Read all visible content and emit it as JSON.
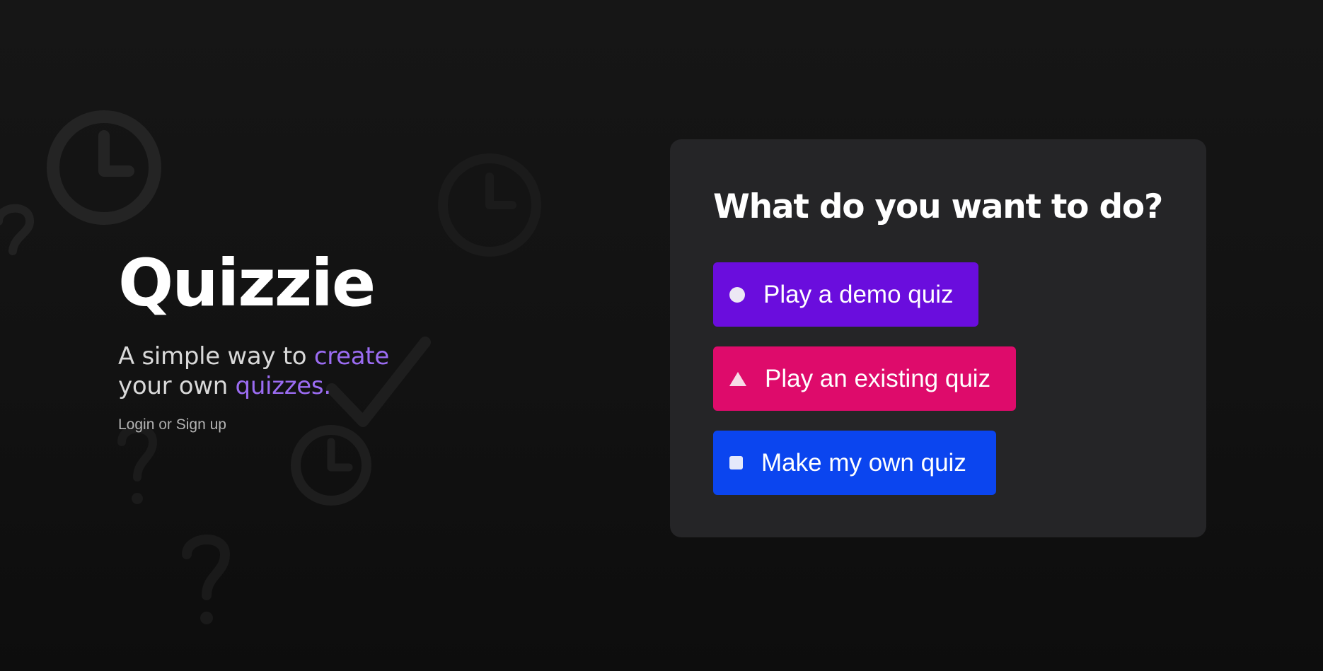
{
  "app": {
    "title": "Quizzie",
    "tagline_part1": "A simple way to ",
    "tagline_accent1": "create",
    "tagline_part2": "your own ",
    "tagline_accent2": "quizzes.",
    "auth_login": "Login",
    "auth_or": " or ",
    "auth_signup": "Sign up"
  },
  "card": {
    "heading": "What do you want to do?",
    "options": [
      {
        "label": "Play a demo quiz",
        "icon": "circle-icon",
        "color": "#6a0ddd"
      },
      {
        "label": "Play an existing quiz",
        "icon": "triangle-icon",
        "color": "#de0b6b"
      },
      {
        "label": "Make my own quiz",
        "icon": "square-icon",
        "color": "#0b45ef"
      }
    ]
  },
  "colors": {
    "background": "#141414",
    "card": "#252527",
    "accent": "#9b6cf2"
  }
}
